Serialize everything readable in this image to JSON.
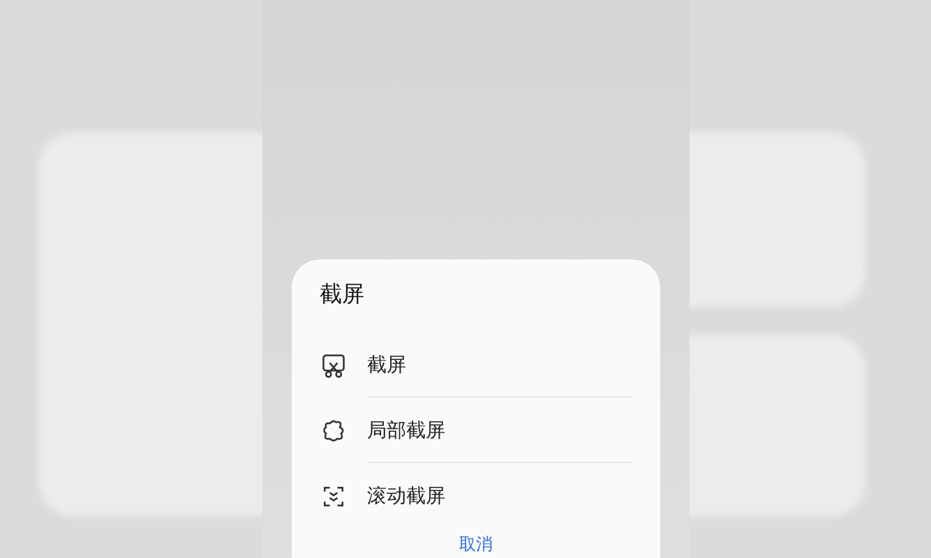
{
  "sheet": {
    "title": "截屏",
    "items": [
      {
        "kind": "full",
        "label": "截屏"
      },
      {
        "kind": "partial",
        "label": "局部截屏"
      },
      {
        "kind": "scroll",
        "label": "滚动截屏"
      }
    ],
    "cancel": "取消"
  }
}
